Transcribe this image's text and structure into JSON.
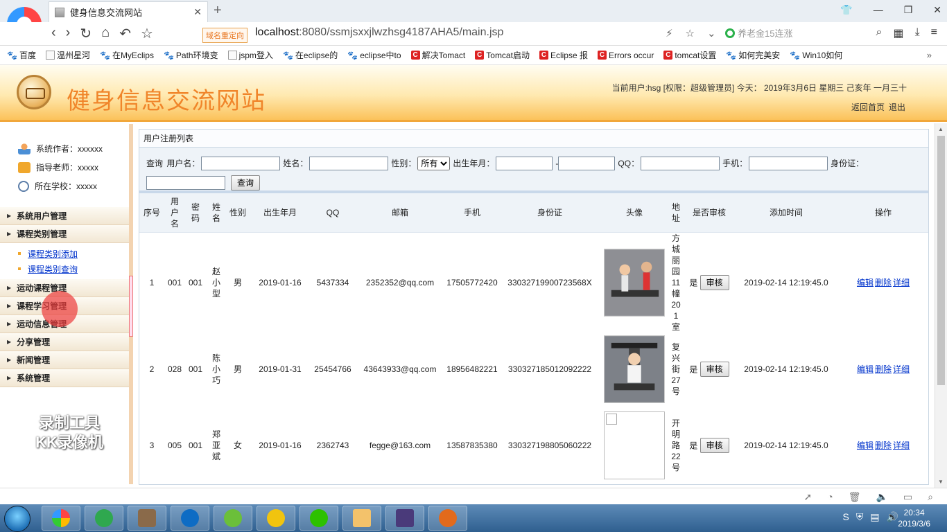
{
  "browser": {
    "tab_title": "健身信息交流网站",
    "redirect_tag": "域名重定向",
    "url_host": "localhost",
    "url_path": ":8080/ssmjsxxjlwzhsg4187AHA5/main.jsp",
    "search_hint": "养老金15连涨",
    "bookmarks": [
      "百度",
      "温州星河",
      "在MyEclips",
      "Path环境变",
      "jspm登入",
      "在eclipse的",
      "eclipse中to",
      "解决Tomact",
      "Tomcat启动",
      "Eclipse 报",
      "Errors occur",
      "tomcat设置",
      "如何完美安",
      "Win10如何"
    ],
    "bookmark_icons": [
      "paw-icon",
      "page-icon",
      "paw-icon",
      "paw-icon",
      "page-icon",
      "paw-icon",
      "paw-icon",
      "c-icon",
      "c-icon",
      "c-icon",
      "c-icon",
      "c-icon",
      "paw-icon",
      "paw-icon"
    ]
  },
  "header": {
    "site_title": "健身信息交流网站",
    "user_info": "当前用户:hsg [权限：超级管理员] 今天： 2019年3月6日 星期三 己亥年 一月三十",
    "home_link": "返回首页",
    "logout_link": "退出"
  },
  "sidebar": {
    "info": [
      {
        "icon": "person-icon",
        "text": "系统作者：xxxxxx"
      },
      {
        "icon": "phone-icon",
        "text": "指导老师：xxxxx"
      },
      {
        "icon": "clock-icon",
        "text": "所在学校：xxxxx"
      }
    ],
    "menu": [
      {
        "label": "系统用户管理"
      },
      {
        "label": "课程类别管理",
        "children": [
          "课程类别添加",
          "课程类别查询"
        ]
      },
      {
        "label": "运动课程管理"
      },
      {
        "label": "课程学习管理"
      },
      {
        "label": "运动信息管理"
      },
      {
        "label": "分享管理"
      },
      {
        "label": "新闻管理"
      },
      {
        "label": "系统管理"
      }
    ],
    "watermark_line1": "录制工具",
    "watermark_line2": "KK录像机"
  },
  "panel": {
    "title": "用户注册列表",
    "filter": {
      "query_label": "查询",
      "username_label": "用户名：",
      "name_label": "姓名：",
      "gender_label": "性别：",
      "gender_selected": "所有",
      "birth_label": "出生年月：",
      "birth_sep": "-",
      "qq_label": "QQ：",
      "phone_label": "手机：",
      "idcard_label": "身份证：",
      "search_button": "查询"
    },
    "columns": [
      "序号",
      "用户名",
      "密码",
      "姓名",
      "性别",
      "出生年月",
      "QQ",
      "邮箱",
      "手机",
      "身份证",
      "头像",
      "地址",
      "是否审核",
      "添加时间",
      "操作"
    ],
    "rows": [
      {
        "no": "1",
        "username": "001",
        "password": "001",
        "name": "赵小型",
        "gender": "男",
        "birth": "2019-01-16",
        "qq": "5437334",
        "email": "2352352@qq.com",
        "phone": "17505772420",
        "idcard": "33032719900723568X",
        "avatar": "treadmill",
        "address": "方城丽园11幢201室",
        "approved": "是",
        "added": "2019-02-14 12:19:45.0"
      },
      {
        "no": "2",
        "username": "028",
        "password": "001",
        "name": "陈小巧",
        "gender": "男",
        "birth": "2019-01-31",
        "qq": "25454766",
        "email": "43643933@qq.com",
        "phone": "18956482221",
        "idcard": "330327185012092222",
        "avatar": "machine",
        "address": "复兴街27号",
        "approved": "是",
        "added": "2019-02-14 12:19:45.0"
      },
      {
        "no": "3",
        "username": "005",
        "password": "001",
        "name": "郑亚斌",
        "gender": "女",
        "birth": "2019-01-16",
        "qq": "2362743",
        "email": "fegge@163.com",
        "phone": "13587835380",
        "idcard": "330327198805060222",
        "avatar": "",
        "address": "开明路22号",
        "approved": "是",
        "added": "2019-02-14 12:19:45.0"
      }
    ],
    "approve_button": "审核",
    "ops": {
      "edit": "编辑",
      "delete": "删除",
      "detail": "详细"
    }
  },
  "taskbar": {
    "time": "20:34",
    "date": "2019/3/6"
  }
}
